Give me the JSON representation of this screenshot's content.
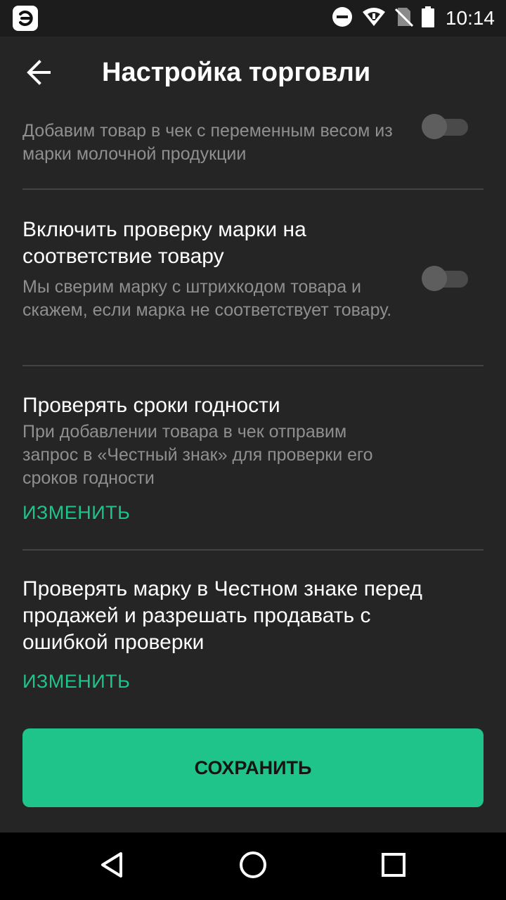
{
  "status_bar": {
    "time": "10:14",
    "icons": [
      "app-e-icon",
      "do-not-disturb-icon",
      "wifi-icon",
      "no-sim-icon",
      "battery-icon"
    ]
  },
  "header": {
    "title": "Настройка торговли",
    "back_icon": "arrow-left-icon"
  },
  "settings": [
    {
      "title": "",
      "description": "Добавим товар в чек с переменным весом из марки молочной продукции",
      "toggle_on": false
    },
    {
      "title": "Включить проверку марки на соответствие товару",
      "description": "Мы сверим марку с штрихкодом товара и скажем, если марка не соответствует товару.",
      "toggle_on": false
    },
    {
      "title": "Проверять сроки годности",
      "description": "При добавлении товара в чек отправим запрос в «Честный знак» для проверки его сроков годности",
      "action_label": "ИЗМЕНИТЬ"
    },
    {
      "title": "Проверять марку в Честном знаке перед продажей и разрешать продавать с ошибкой проверки",
      "action_label": "ИЗМЕНИТЬ"
    }
  ],
  "save_button": {
    "label": "СОХРАНИТЬ"
  },
  "nav_bar": {
    "icons": [
      "back-triangle-icon",
      "home-circle-icon",
      "recents-square-icon"
    ]
  },
  "colors": {
    "background": "#252525",
    "accent": "#1fc48b",
    "secondary_text": "#8f8f8f",
    "divider": "#434343"
  }
}
